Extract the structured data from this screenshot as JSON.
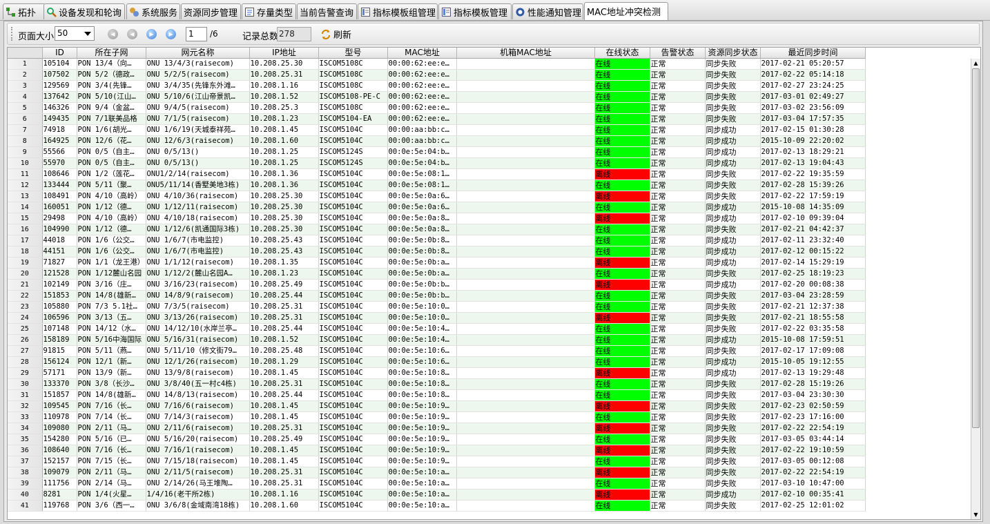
{
  "tabs": [
    {
      "label": "拓扑",
      "icon": "topology-icon",
      "active": false
    },
    {
      "label": "设备发现和轮询",
      "icon": "device-discovery-icon",
      "active": false
    },
    {
      "label": "系统服务",
      "icon": "system-service-icon",
      "active": false
    },
    {
      "label": "资源同步管理",
      "icon": "",
      "active": false
    },
    {
      "label": "存量类型",
      "icon": "inventory-icon",
      "active": false
    },
    {
      "label": "当前告警查询",
      "icon": "",
      "active": false
    },
    {
      "label": "指标模板组管理",
      "icon": "template-group-icon",
      "active": false
    },
    {
      "label": "指标模板管理",
      "icon": "template-icon",
      "active": false
    },
    {
      "label": "性能通知管理",
      "icon": "notification-icon",
      "active": false
    },
    {
      "label": "MAC地址冲突检测",
      "icon": "",
      "active": true
    }
  ],
  "toolbar": {
    "page_size_label": "页面大小",
    "page_size_value": "50",
    "current_page": "1",
    "total_pages": "/6",
    "record_total_label": "记录总数",
    "record_total_value": "278",
    "refresh_label": "刷新"
  },
  "columns": [
    "ID",
    "所在子网",
    "网元名称",
    "IP地址",
    "型号",
    "MAC地址",
    "机箱MAC地址",
    "在线状态",
    "告警状态",
    "资源同步状态",
    "最近同步时间"
  ],
  "status_colors": {
    "在线": "#00ff00",
    "离线": "#ff0000"
  },
  "rows": [
    [
      "1",
      "105104",
      "PON 13/4（向…",
      "ONU 13/4/3(raisecom)",
      "10.208.25.30",
      "ISCOM5108C",
      "00:00:62:ee:e…",
      "",
      "在线",
      "正常",
      "同步失败",
      "2017-02-21 05:20:57"
    ],
    [
      "2",
      "107502",
      "PON 5/2（德政…",
      "ONU 5/2/5(raisecom)",
      "10.208.25.31",
      "ISCOM5108C",
      "00:00:62:ee:e…",
      "",
      "在线",
      "正常",
      "同步失败",
      "2017-02-22 05:14:18"
    ],
    [
      "3",
      "129569",
      "PON 3/4(先锋…",
      "ONU 3/4/35(先锋东外滩…",
      "10.208.1.16",
      "ISCOM5108C",
      "00:00:62:ee:e…",
      "",
      "在线",
      "正常",
      "同步失败",
      "2017-02-27 23:24:25"
    ],
    [
      "4",
      "137642",
      "PON 5/10(江山…",
      "ONU 5/10/6(江山帝景凯…",
      "10.208.1.52",
      "ISCOM5108-PE-C",
      "00:00:62:ee:e…",
      "",
      "在线",
      "正常",
      "同步失败",
      "2017-03-01 02:49:27"
    ],
    [
      "5",
      "146326",
      "PON 9/4（金盆…",
      "ONU 9/4/5(raisecom)",
      "10.208.25.3",
      "ISCOM5108C",
      "00:00:62:ee:e…",
      "",
      "在线",
      "正常",
      "同步失败",
      "2017-03-02 23:56:09"
    ],
    [
      "6",
      "149435",
      "PON 7/1联美品格",
      "ONU 7/1/5(raisecom)",
      "10.208.1.23",
      "ISCOM5104-EA",
      "00:00:62:ee:e…",
      "",
      "在线",
      "正常",
      "同步失败",
      "2017-03-04 17:57:35"
    ],
    [
      "7",
      "74918",
      "PON 1/6(胡光…",
      "ONU 1/6/19(天城泰祥苑…",
      "10.208.1.45",
      "ISCOM5104C",
      "00:00:aa:bb:c…",
      "",
      "在线",
      "正常",
      "同步成功",
      "2017-02-15 01:30:28"
    ],
    [
      "8",
      "164925",
      "PON 12/6（花…",
      "ONU 12/6/3(raisecom)",
      "10.208.1.60",
      "ISCOM5104C",
      "00:00:aa:bb:c…",
      "",
      "在线",
      "正常",
      "同步成功",
      "2015-10-09 22:20:02"
    ],
    [
      "9",
      "55566",
      "PON 0/5（自主…",
      "ONU 0/5/13()",
      "10.208.1.25",
      "ISCOM5124S",
      "00:0e:5e:04:b…",
      "",
      "在线",
      "正常",
      "同步成功",
      "2017-02-13 18:29:21"
    ],
    [
      "10",
      "55970",
      "PON 0/5（自主…",
      "ONU 0/5/13()",
      "10.208.1.25",
      "ISCOM5124S",
      "00:0e:5e:04:b…",
      "",
      "在线",
      "正常",
      "同步成功",
      "2017-02-13 19:04:43"
    ],
    [
      "11",
      "108646",
      "PON 1/2（莲花…",
      "ONU1/2/14(raisecom)",
      "10.208.1.36",
      "ISCOM5104C",
      "00:0e:5e:08:1…",
      "",
      "离线",
      "正常",
      "同步失败",
      "2017-02-22 19:35:59"
    ],
    [
      "12",
      "133444",
      "PON 5/11（聚…",
      "ONU5/11/14(香墅美地3栋)",
      "10.208.1.36",
      "ISCOM5104C",
      "00:0e:5e:08:1…",
      "",
      "在线",
      "正常",
      "同步失败",
      "2017-02-28 15:39:26"
    ],
    [
      "13",
      "108491",
      "PON 4/10（高岭）",
      "ONU 4/10/36(raisecom)",
      "10.208.25.30",
      "ISCOM5104C",
      "00:0e:5e:0a:6…",
      "",
      "离线",
      "正常",
      "同步失败",
      "2017-02-22 17:59:19"
    ],
    [
      "14",
      "160051",
      "PON 1/12（德…",
      "ONU 1/12/11(raisecom)",
      "10.208.25.30",
      "ISCOM5104C",
      "00:0e:5e:0a:6…",
      "",
      "在线",
      "正常",
      "同步成功",
      "2015-10-08 14:35:09"
    ],
    [
      "15",
      "29498",
      "PON 4/10（高岭）",
      "ONU 4/10/18(raisecom)",
      "10.208.25.30",
      "ISCOM5104C",
      "00:0e:5e:0a:8…",
      "",
      "离线",
      "正常",
      "同步成功",
      "2017-02-10 09:39:04"
    ],
    [
      "16",
      "104990",
      "PON 1/12（德…",
      "ONU 1/12/6(凯通国际3栋)",
      "10.208.25.30",
      "ISCOM5104C",
      "00:0e:5e:0a:8…",
      "",
      "在线",
      "正常",
      "同步失败",
      "2017-02-21 04:42:37"
    ],
    [
      "17",
      "44018",
      "PON 1/6（公交…",
      "ONU 1/6/7(市电监控)",
      "10.208.25.43",
      "ISCOM5104C",
      "00:0e:5e:0b:8…",
      "",
      "在线",
      "正常",
      "同步成功",
      "2017-02-11 23:32:40"
    ],
    [
      "18",
      "44151",
      "PON 1/6（公交…",
      "ONU 1/6/7(市电监控)",
      "10.208.25.43",
      "ISCOM5104C",
      "00:0e:5e:0b:8…",
      "",
      "在线",
      "正常",
      "同步成功",
      "2017-02-12 00:15:22"
    ],
    [
      "19",
      "71827",
      "PON 1/1（龙王港）",
      "ONU 1/1/12(raisecom)",
      "10.208.1.35",
      "ISCOM5104C",
      "00:0e:5e:0b:a…",
      "",
      "离线",
      "正常",
      "同步成功",
      "2017-02-14 15:29:19"
    ],
    [
      "20",
      "121528",
      "PON 1/12麓山名园",
      "ONU 1/12/2(麓山名园A…",
      "10.208.1.23",
      "ISCOM5104C",
      "00:0e:5e:0b:a…",
      "",
      "在线",
      "正常",
      "同步失败",
      "2017-02-25 18:19:23"
    ],
    [
      "21",
      "102149",
      "PON 3/16（庄…",
      "ONU 3/16/23(raisecom)",
      "10.208.25.49",
      "ISCOM5104C",
      "00:0e:5e:0b:b…",
      "",
      "离线",
      "正常",
      "同步成功",
      "2017-02-20 00:08:38"
    ],
    [
      "22",
      "151853",
      "PON 14/8(雄新…",
      "ONU 14/8/9(raisecom)",
      "10.208.25.44",
      "ISCOM5104C",
      "00:0e:5e:0b:b…",
      "",
      "在线",
      "正常",
      "同步失败",
      "2017-03-04 23:28:59"
    ],
    [
      "23",
      "105880",
      "PON 7/3 5.1社…",
      "ONU 7/3/5(raisecom)",
      "10.208.25.31",
      "ISCOM5104C",
      "00:0e:5e:10:0…",
      "",
      "在线",
      "正常",
      "同步失败",
      "2017-02-21 12:37:38"
    ],
    [
      "24",
      "106596",
      "PON 3/13（五…",
      "ONU 3/13/26(raisecom)",
      "10.208.25.31",
      "ISCOM5104C",
      "00:0e:5e:10:0…",
      "",
      "离线",
      "正常",
      "同步失败",
      "2017-02-21 18:55:58"
    ],
    [
      "25",
      "107148",
      "PON 14/12（水…",
      "ONU 14/12/10(水岸兰亭…",
      "10.208.25.44",
      "ISCOM5104C",
      "00:0e:5e:10:4…",
      "",
      "在线",
      "正常",
      "同步失败",
      "2017-02-22 03:35:58"
    ],
    [
      "26",
      "158189",
      "PON 5/16中海国际",
      "ONU 5/16/31(raisecom)",
      "10.208.1.52",
      "ISCOM5104C",
      "00:0e:5e:10:4…",
      "",
      "在线",
      "正常",
      "同步成功",
      "2015-10-08 17:59:51"
    ],
    [
      "27",
      "91815",
      "PON 5/11（燕…",
      "ONU 5/11/10（修文街79…",
      "10.208.25.48",
      "ISCOM5104C",
      "00:0e:5e:10:6…",
      "",
      "在线",
      "正常",
      "同步失败",
      "2017-02-17 17:09:08"
    ],
    [
      "28",
      "156124",
      "PON 12/1（新…",
      "ONU 12/1/26(raisecom)",
      "10.208.1.29",
      "ISCOM5104C",
      "00:0e:5e:10:6…",
      "",
      "在线",
      "正常",
      "同步成功",
      "2015-10-05 19:12:55"
    ],
    [
      "29",
      "57171",
      "PON 13/9（新…",
      "ONU 13/9/8(raisecom)",
      "10.208.1.45",
      "ISCOM5104C",
      "00:0e:5e:10:8…",
      "",
      "离线",
      "正常",
      "同步成功",
      "2017-02-13 19:29:48"
    ],
    [
      "30",
      "133370",
      "PON 3/8（长沙…",
      "ONU 3/8/40(五一村c4栋)",
      "10.208.25.31",
      "ISCOM5104C",
      "00:0e:5e:10:8…",
      "",
      "在线",
      "正常",
      "同步失败",
      "2017-02-28 15:19:26"
    ],
    [
      "31",
      "151857",
      "PON 14/8(雄新…",
      "ONU 14/8/13(raisecom)",
      "10.208.25.44",
      "ISCOM5104C",
      "00:0e:5e:10:8…",
      "",
      "在线",
      "正常",
      "同步失败",
      "2017-03-04 23:30:30"
    ],
    [
      "32",
      "109545",
      "PON 7/16（长…",
      "ONU 7/16/6(raisecom)",
      "10.208.1.45",
      "ISCOM5104C",
      "00:0e:5e:10:9…",
      "",
      "离线",
      "正常",
      "同步失败",
      "2017-02-23 02:50:59"
    ],
    [
      "33",
      "110978",
      "PON 7/14（长…",
      "ONU 7/14/3(raisecom)",
      "10.208.1.45",
      "ISCOM5104C",
      "00:0e:5e:10:9…",
      "",
      "在线",
      "正常",
      "同步失败",
      "2017-02-23 17:16:00"
    ],
    [
      "34",
      "109080",
      "PON 2/11（马…",
      "ONU 2/11/6(raisecom)",
      "10.208.25.31",
      "ISCOM5104C",
      "00:0e:5e:10:9…",
      "",
      "离线",
      "正常",
      "同步失败",
      "2017-02-22 22:54:19"
    ],
    [
      "35",
      "154280",
      "PON 5/16（已…",
      "ONU 5/16/20(raisecom)",
      "10.208.25.49",
      "ISCOM5104C",
      "00:0e:5e:10:9…",
      "",
      "在线",
      "正常",
      "同步失败",
      "2017-03-05 03:44:14"
    ],
    [
      "36",
      "108640",
      "PON 7/16（长…",
      "ONU 7/16/1(raisecom)",
      "10.208.1.45",
      "ISCOM5104C",
      "00:0e:5e:10:9…",
      "",
      "离线",
      "正常",
      "同步失败",
      "2017-02-22 19:10:59"
    ],
    [
      "37",
      "152157",
      "PON 7/15（长…",
      "ONU 7/15/18(raisecom)",
      "10.208.1.45",
      "ISCOM5104C",
      "00:0e:5e:10:9…",
      "",
      "在线",
      "正常",
      "同步失败",
      "2017-03-05 00:12:08"
    ],
    [
      "38",
      "109079",
      "PON 2/11（马…",
      "ONU 2/11/5(raisecom)",
      "10.208.25.31",
      "ISCOM5104C",
      "00:0e:5e:10:a…",
      "",
      "离线",
      "正常",
      "同步失败",
      "2017-02-22 22:54:19"
    ],
    [
      "39",
      "111756",
      "PON 2/14（马…",
      "ONU 2/14/26(马王堆陶…",
      "10.208.25.31",
      "ISCOM5104C",
      "00:0e:5e:10:a…",
      "",
      "在线",
      "正常",
      "同步失败",
      "2017-03-10 10:47:00"
    ],
    [
      "40",
      "8281",
      "PON 1/4(火星…",
      "1/4/16(老干所2栋)",
      "10.208.1.16",
      "ISCOM5104C",
      "00:0e:5e:10:a…",
      "",
      "离线",
      "正常",
      "同步成功",
      "2017-02-10 00:35:41"
    ],
    [
      "41",
      "119768",
      "PON 3/6（西一…",
      "ONU 3/6/8(金域南湾18栋)",
      "10.208.1.60",
      "ISCOM5104C",
      "00:0e:5e:10:a…",
      "",
      "在线",
      "正常",
      "同步失败",
      "2017-02-25 12:01:02"
    ]
  ]
}
